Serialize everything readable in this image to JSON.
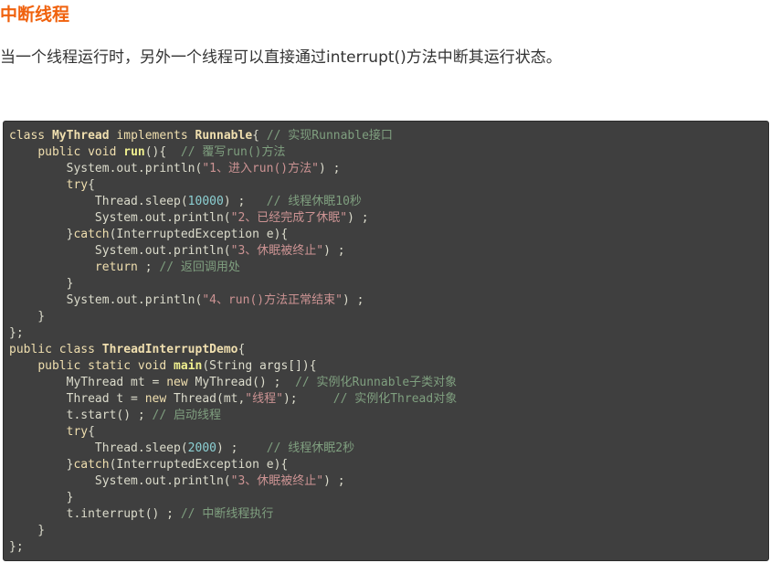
{
  "title": "中断线程",
  "intro": "当一个线程运行时，另外一个线程可以直接通过interrupt()方法中断其运行状态。",
  "colors": {
    "title": "#f0620e",
    "intro_text": "#333333",
    "code_background": "#3f3f3f",
    "code_plain": "#dcdccc",
    "code_keyword": "#f0dfaf",
    "code_function": "#efef8f",
    "code_number": "#8cd0d3",
    "code_string": "#cc9393",
    "code_comment": "#7f9f7f"
  },
  "code": {
    "lines": [
      [
        [
          "kw",
          "class"
        ],
        [
          "plain",
          " "
        ],
        [
          "type",
          "MyThread"
        ],
        [
          "plain",
          " "
        ],
        [
          "kw",
          "implements"
        ],
        [
          "plain",
          " "
        ],
        [
          "type",
          "Runnable"
        ],
        [
          "plain",
          "{ "
        ],
        [
          "comment",
          "// 实现Runnable接口"
        ]
      ],
      [
        [
          "plain",
          "    "
        ],
        [
          "kw",
          "public"
        ],
        [
          "plain",
          " "
        ],
        [
          "kw",
          "void"
        ],
        [
          "plain",
          " "
        ],
        [
          "fn",
          "run"
        ],
        [
          "plain",
          "(){  "
        ],
        [
          "comment",
          "// 覆写run()方法"
        ]
      ],
      [
        [
          "plain",
          "        System.out.println("
        ],
        [
          "str",
          "\"1、进入run()方法\""
        ],
        [
          "plain",
          ") ;"
        ]
      ],
      [
        [
          "plain",
          "        "
        ],
        [
          "kw",
          "try"
        ],
        [
          "plain",
          "{"
        ]
      ],
      [
        [
          "plain",
          "            Thread.sleep("
        ],
        [
          "num",
          "10000"
        ],
        [
          "plain",
          ") ;   "
        ],
        [
          "comment",
          "// 线程休眠10秒"
        ]
      ],
      [
        [
          "plain",
          "            System.out.println("
        ],
        [
          "str",
          "\"2、已经完成了休眠\""
        ],
        [
          "plain",
          ") ;"
        ]
      ],
      [
        [
          "plain",
          "        }"
        ],
        [
          "kw",
          "catch"
        ],
        [
          "plain",
          "(InterruptedException e){"
        ]
      ],
      [
        [
          "plain",
          "            System.out.println("
        ],
        [
          "str",
          "\"3、休眠被终止\""
        ],
        [
          "plain",
          ") ;"
        ]
      ],
      [
        [
          "plain",
          "            "
        ],
        [
          "kw",
          "return"
        ],
        [
          "plain",
          " ; "
        ],
        [
          "comment",
          "// 返回调用处"
        ]
      ],
      [
        [
          "plain",
          "        }"
        ]
      ],
      [
        [
          "plain",
          "        System.out.println("
        ],
        [
          "str",
          "\"4、run()方法正常结束\""
        ],
        [
          "plain",
          ") ;"
        ]
      ],
      [
        [
          "plain",
          "    }"
        ]
      ],
      [
        [
          "plain",
          "};"
        ]
      ],
      [
        [
          "kw",
          "public"
        ],
        [
          "plain",
          " "
        ],
        [
          "kw",
          "class"
        ],
        [
          "plain",
          " "
        ],
        [
          "type",
          "ThreadInterruptDemo"
        ],
        [
          "plain",
          "{"
        ]
      ],
      [
        [
          "plain",
          "    "
        ],
        [
          "kw",
          "public"
        ],
        [
          "plain",
          " "
        ],
        [
          "kw",
          "static"
        ],
        [
          "plain",
          " "
        ],
        [
          "kw",
          "void"
        ],
        [
          "plain",
          " "
        ],
        [
          "fn",
          "main"
        ],
        [
          "plain",
          "(String args[]){"
        ]
      ],
      [
        [
          "plain",
          "        MyThread mt = "
        ],
        [
          "kw",
          "new"
        ],
        [
          "plain",
          " MyThread() ;  "
        ],
        [
          "comment",
          "// 实例化Runnable子类对象"
        ]
      ],
      [
        [
          "plain",
          "        Thread t = "
        ],
        [
          "kw",
          "new"
        ],
        [
          "plain",
          " Thread(mt,"
        ],
        [
          "str",
          "\"线程\""
        ],
        [
          "plain",
          ");     "
        ],
        [
          "comment",
          "// 实例化Thread对象"
        ]
      ],
      [
        [
          "plain",
          "        t.start() ; "
        ],
        [
          "comment",
          "// 启动线程"
        ]
      ],
      [
        [
          "plain",
          "        "
        ],
        [
          "kw",
          "try"
        ],
        [
          "plain",
          "{"
        ]
      ],
      [
        [
          "plain",
          "            Thread.sleep("
        ],
        [
          "num",
          "2000"
        ],
        [
          "plain",
          ") ;    "
        ],
        [
          "comment",
          "// 线程休眠2秒"
        ]
      ],
      [
        [
          "plain",
          "        }"
        ],
        [
          "kw",
          "catch"
        ],
        [
          "plain",
          "(InterruptedException e){"
        ]
      ],
      [
        [
          "plain",
          "            System.out.println("
        ],
        [
          "str",
          "\"3、休眠被终止\""
        ],
        [
          "plain",
          ") ;"
        ]
      ],
      [
        [
          "plain",
          "        }"
        ]
      ],
      [
        [
          "plain",
          "        t.interrupt() ; "
        ],
        [
          "comment",
          "// 中断线程执行"
        ]
      ],
      [
        [
          "plain",
          "    }"
        ]
      ],
      [
        [
          "plain",
          "};"
        ]
      ]
    ]
  }
}
